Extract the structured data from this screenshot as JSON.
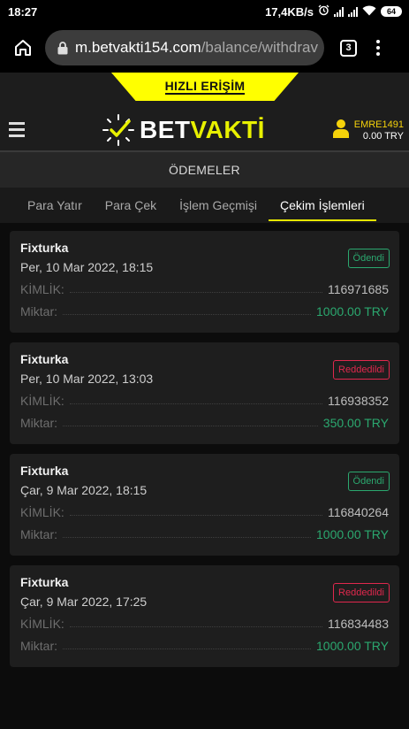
{
  "status_bar": {
    "time": "18:27",
    "net_speed": "17,4KB/s",
    "battery": "64"
  },
  "browser": {
    "url_host": "m.betvakti154.com",
    "url_path": "/balance/withdrav",
    "tab_count": "3"
  },
  "header": {
    "quick_access": "HIZLI ERİŞİM",
    "logo": {
      "part1": "BET",
      "part2": "VAKTİ"
    },
    "user": {
      "name": "EMRE1491",
      "balance": "0.00 TRY"
    }
  },
  "page_title": "ÖDEMELER",
  "tabs": [
    {
      "label": "Para Yatır",
      "active": false
    },
    {
      "label": "Para Çek",
      "active": false
    },
    {
      "label": "İşlem Geçmişi",
      "active": false
    },
    {
      "label": "Çekim İşlemleri",
      "active": true
    }
  ],
  "labels": {
    "id": "KİMLİK:",
    "amount": "Miktar:"
  },
  "transactions": [
    {
      "method": "Fixturka",
      "date": "Per, 10 Mar 2022, 18:15",
      "status": "Ödendi",
      "status_type": "paid",
      "id": "116971685",
      "amount": "1000.00 TRY"
    },
    {
      "method": "Fixturka",
      "date": "Per, 10 Mar 2022, 13:03",
      "status": "Reddedildi",
      "status_type": "rejected",
      "id": "116938352",
      "amount": "350.00 TRY"
    },
    {
      "method": "Fixturka",
      "date": "Çar, 9 Mar 2022, 18:15",
      "status": "Ödendi",
      "status_type": "paid",
      "id": "116840264",
      "amount": "1000.00 TRY"
    },
    {
      "method": "Fixturka",
      "date": "Çar, 9 Mar 2022, 17:25",
      "status": "Reddedildi",
      "status_type": "rejected",
      "id": "116834483",
      "amount": "1000.00 TRY"
    }
  ],
  "colors": {
    "brand_yellow": "#ffff00",
    "paid": "#2ba86f",
    "rejected": "#e0284d",
    "user_gold": "#f5d20a"
  },
  "icons": [
    "alarm-icon",
    "signal-icon",
    "wifi-icon",
    "battery-icon",
    "home-icon",
    "lock-icon",
    "tabs-icon",
    "more-vert-icon",
    "hamburger-icon",
    "clock-check-icon",
    "user-icon"
  ]
}
